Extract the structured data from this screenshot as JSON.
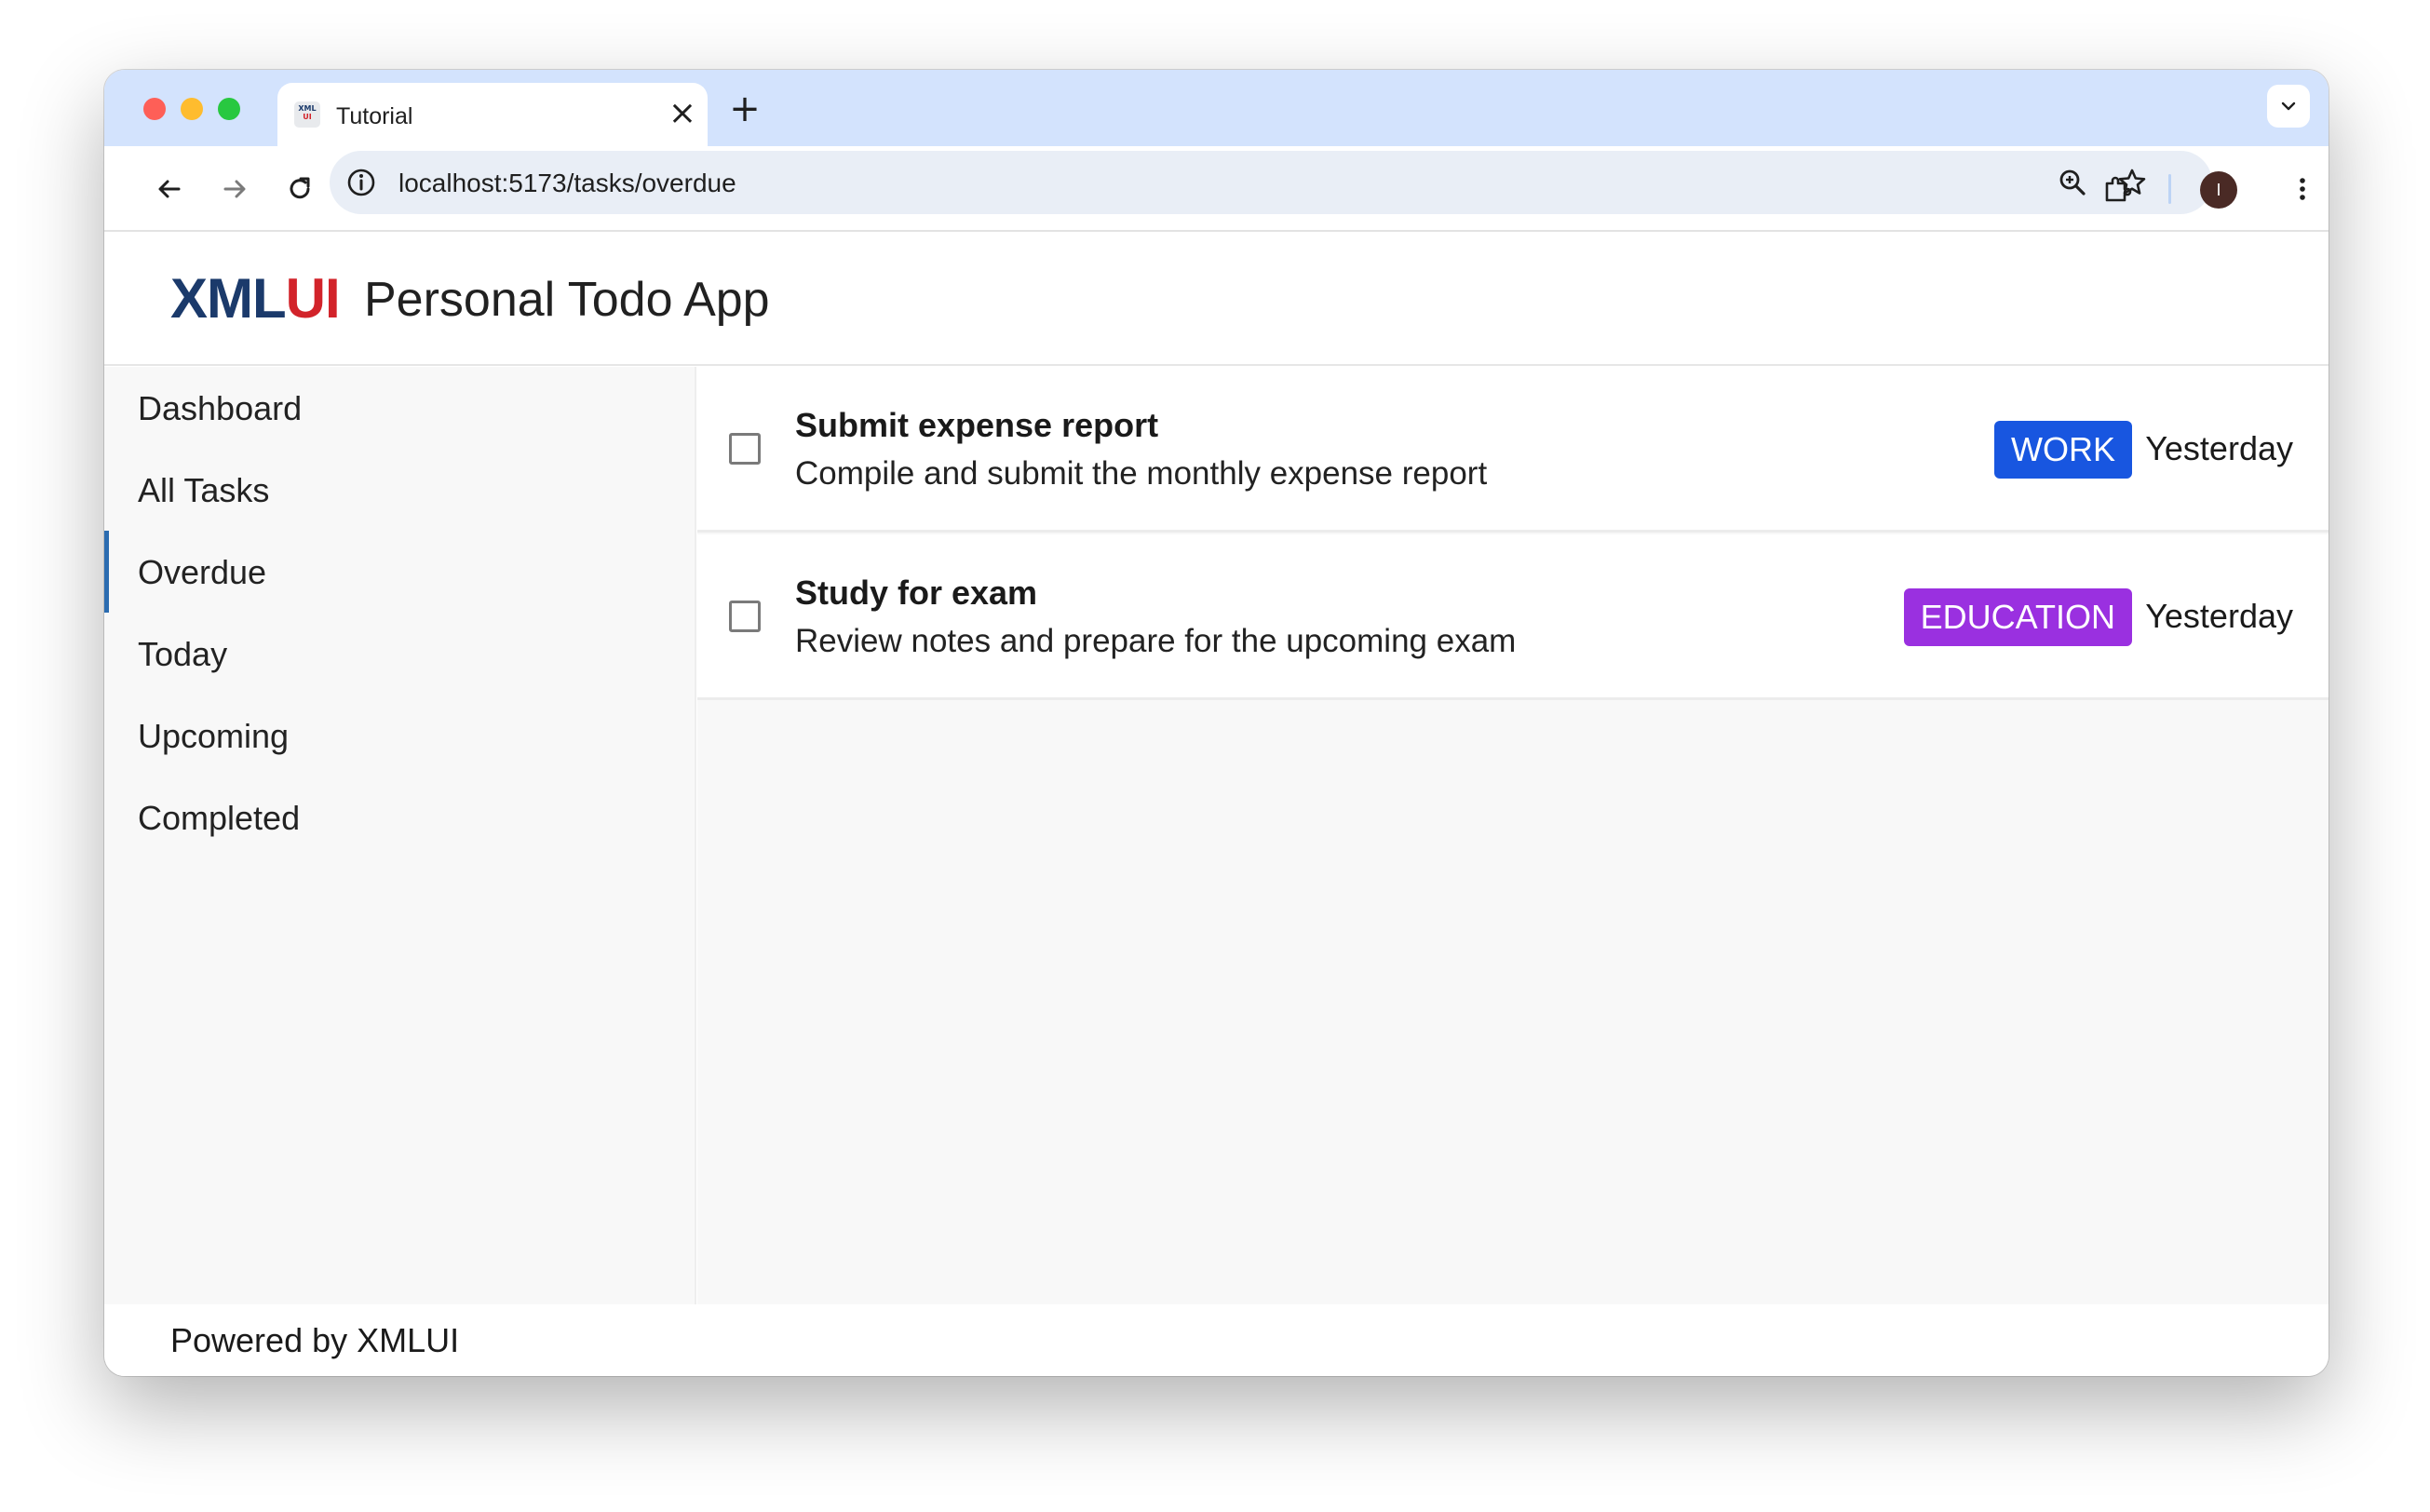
{
  "browser": {
    "tab": {
      "title": "Tutorial",
      "favicon_top": "XML",
      "favicon_bottom": "UI"
    },
    "address": {
      "url": "localhost:5173/tasks/overdue"
    },
    "profile_initial": "I"
  },
  "app": {
    "logo": {
      "part1": "XML",
      "part2": "UI"
    },
    "title": "Personal Todo App",
    "footer": "Powered by XMLUI"
  },
  "nav": {
    "items": [
      {
        "label": "Dashboard",
        "active": false
      },
      {
        "label": "All Tasks",
        "active": false
      },
      {
        "label": "Overdue",
        "active": true
      },
      {
        "label": "Today",
        "active": false
      },
      {
        "label": "Upcoming",
        "active": false
      },
      {
        "label": "Completed",
        "active": false
      }
    ]
  },
  "tasks": [
    {
      "title": "Submit expense report",
      "description": "Compile and submit the monthly expense report",
      "category": "WORK",
      "category_color": "#1856e0",
      "due": "Yesterday",
      "checked": false
    },
    {
      "title": "Study for exam",
      "description": "Review notes and prepare for the upcoming exam",
      "category": "EDUCATION",
      "category_color": "#9a30e0",
      "due": "Yesterday",
      "checked": false
    }
  ],
  "colors": {
    "nav_active_indicator": "#2b6cb0",
    "logo_xml": "#1b3a6b",
    "logo_ui": "#d2232a"
  },
  "icons": [
    "close-icon",
    "plus-icon",
    "chevron-down-icon",
    "back-arrow-icon",
    "forward-arrow-icon",
    "reload-icon",
    "site-info-icon",
    "zoom-icon",
    "star-icon",
    "extensions-icon",
    "more-vertical-icon"
  ]
}
